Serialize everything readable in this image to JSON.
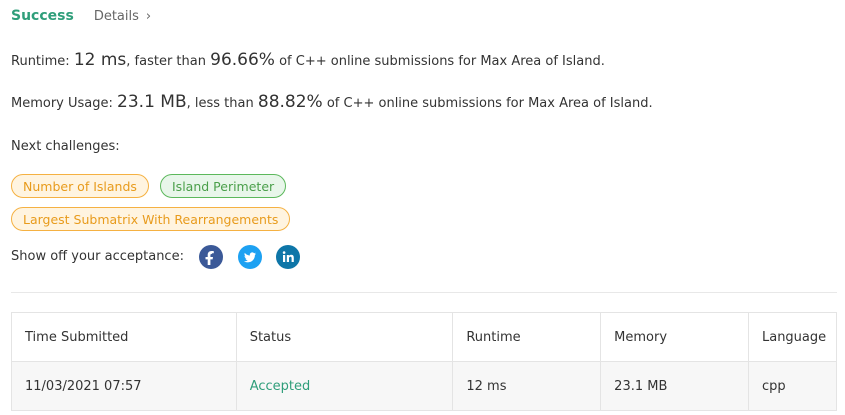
{
  "header": {
    "status": "Success",
    "details_label": "Details",
    "details_chevron": "›"
  },
  "runtime": {
    "label": "Runtime:",
    "value": "12 ms",
    "comparison": ", faster than",
    "percent": "96.66%",
    "suffix": "of C++ online submissions for Max Area of Island."
  },
  "memory": {
    "label": "Memory Usage:",
    "value": "23.1 MB",
    "comparison": ", less than",
    "percent": "88.82%",
    "suffix": "of C++ online submissions for Max Area of Island."
  },
  "next_challenges": {
    "label": "Next challenges:",
    "tags": [
      {
        "label": "Number of Islands",
        "color": "#f5b142"
      },
      {
        "label": "Island Perimeter",
        "color": "#5cb85c"
      },
      {
        "label": "Largest Submatrix With Rearrangements",
        "color": "#f5b142"
      }
    ]
  },
  "share": {
    "label": "Show off your acceptance:",
    "icons": [
      "facebook-icon",
      "twitter-icon",
      "linkedin-icon"
    ]
  },
  "table": {
    "headers": [
      "Time Submitted",
      "Status",
      "Runtime",
      "Memory",
      "Language"
    ],
    "rows": [
      [
        "11/03/2021 07:57",
        "Accepted",
        "12 ms",
        "23.1 MB",
        "cpp"
      ]
    ]
  },
  "colors": {
    "success": "#2f9e7a",
    "accepted": "#2f9e7a"
  }
}
